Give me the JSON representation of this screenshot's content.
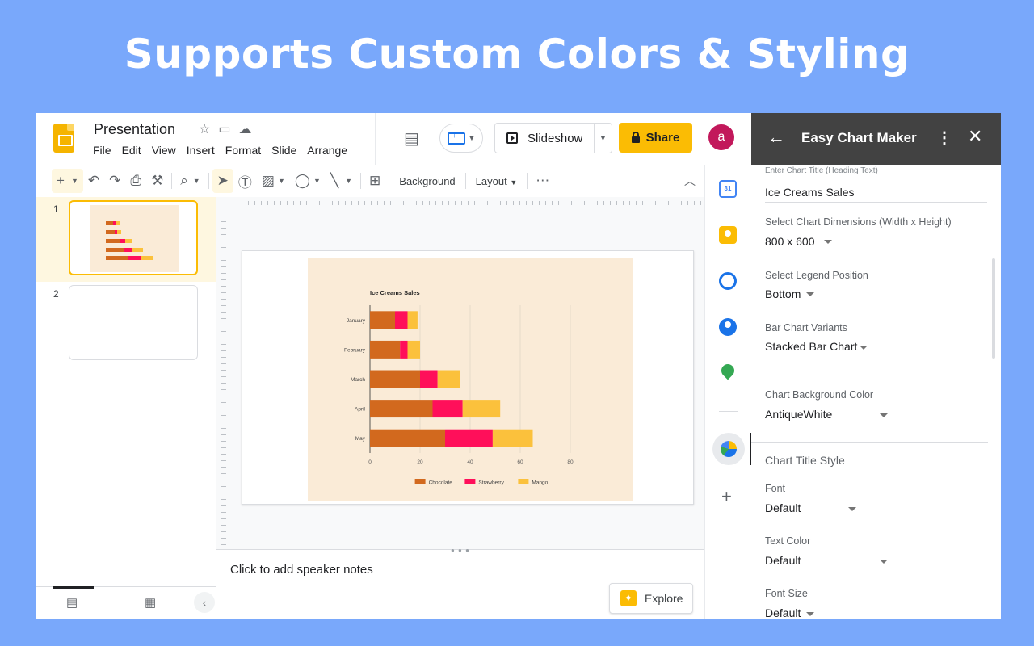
{
  "banner": {
    "title": "Supports Custom Colors & Styling"
  },
  "header": {
    "doc_title": "Presentation",
    "menu": [
      "File",
      "Edit",
      "View",
      "Insert",
      "Format",
      "Slide",
      "Arrange"
    ],
    "slideshow_label": "Slideshow",
    "share_label": "Share",
    "avatar_letter": "a"
  },
  "toolbar": {
    "background_label": "Background",
    "layout_label": "Layout"
  },
  "filmstrip": {
    "slides": [
      {
        "number": "1"
      },
      {
        "number": "2"
      }
    ]
  },
  "notes": {
    "placeholder": "Click to add speaker notes"
  },
  "explore": {
    "label": "Explore"
  },
  "rail": {
    "calendar_day": "31"
  },
  "panel": {
    "title": "Easy Chart Maker",
    "fields": {
      "chart_title_label": "Enter Chart Title (Heading Text)",
      "chart_title_value": "Ice Creams Sales",
      "dimensions_label": "Select Chart Dimensions (Width x Height)",
      "dimensions_value": "800 x 600",
      "legend_label": "Select Legend Position",
      "legend_value": "Bottom",
      "variant_label": "Bar Chart Variants",
      "variant_value": "Stacked Bar Chart",
      "bg_color_label": "Chart Background Color",
      "bg_color_value": "AntiqueWhite",
      "title_style_heading": "Chart Title Style",
      "font_label": "Font",
      "font_value": "Default",
      "text_color_label": "Text Color",
      "text_color_value": "Default",
      "font_size_label": "Font Size",
      "font_size_value": "Default"
    }
  },
  "colors": {
    "accent_yellow": "#fbbc04",
    "panel_header": "#424242",
    "chart_background": "#faebd7"
  },
  "chart_data": {
    "type": "bar",
    "orientation": "horizontal",
    "stacked": true,
    "title": "Ice Creams Sales",
    "categories": [
      "January",
      "February",
      "March",
      "April",
      "May"
    ],
    "series": [
      {
        "name": "Chocolate",
        "color": "#d2691e",
        "values": [
          10,
          12,
          20,
          25,
          30
        ]
      },
      {
        "name": "Strawberry",
        "color": "#ff0f5a",
        "values": [
          5,
          3,
          7,
          12,
          19
        ]
      },
      {
        "name": "Mango",
        "color": "#fbc13c",
        "values": [
          4,
          5,
          9,
          15,
          16
        ]
      }
    ],
    "xlim": [
      0,
      80
    ],
    "xticks": [
      0,
      20,
      40,
      60,
      80
    ],
    "grid": true,
    "legend_position": "bottom",
    "background": "#faebd7"
  }
}
